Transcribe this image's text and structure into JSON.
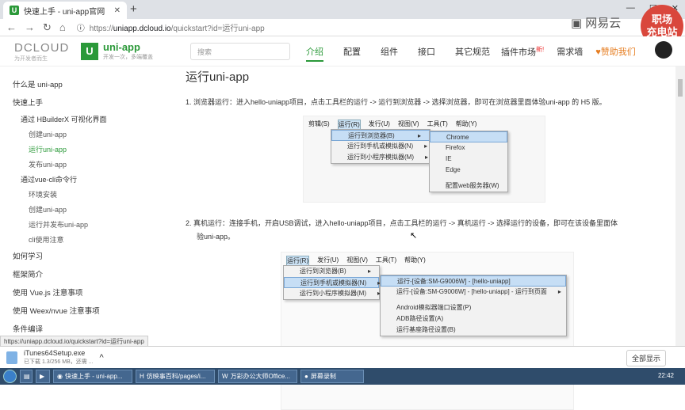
{
  "browser": {
    "tab_title": "快速上手 - uni-app官网",
    "new_tab": "+",
    "url_prefix": "https://",
    "url_host": "uniapp.dcloud.io",
    "url_path": "/quickstart?id=运行uni-app",
    "window_controls": [
      "—",
      "☐",
      "✕"
    ]
  },
  "overlay": {
    "wangyi": "网易云",
    "badge_line1": "职场",
    "badge_line2": "充电站"
  },
  "site": {
    "dcloud_logo": "DCLOUD",
    "dcloud_tagline": "为开发者而生",
    "uniapp_logo": "uni-app",
    "uniapp_tagline": "开发一次，多端覆盖",
    "search_placeholder": "搜索",
    "nav": [
      "介绍",
      "配置",
      "组件",
      "接口",
      "其它规范"
    ],
    "right_nav": {
      "plugins": "插件市场",
      "new": "新!",
      "demand": "需求墙",
      "sponsor": "赞助我们"
    }
  },
  "sidebar": [
    {
      "label": "什么是 uni-app",
      "level": 1
    },
    {
      "label": "快速上手",
      "level": 1
    },
    {
      "label": "通过 HBuilderX 可视化界面",
      "level": 2
    },
    {
      "label": "创建uni-app",
      "level": 3
    },
    {
      "label": "运行uni-app",
      "level": 3,
      "current": true
    },
    {
      "label": "发布uni-app",
      "level": 3
    },
    {
      "label": "通过vue-cli命令行",
      "level": 2
    },
    {
      "label": "环境安装",
      "level": 3
    },
    {
      "label": "创建uni-app",
      "level": 3
    },
    {
      "label": "运行并发布uni-app",
      "level": 3
    },
    {
      "label": "cli使用注意",
      "level": 3
    },
    {
      "label": "如何学习",
      "level": 1
    },
    {
      "label": "框架简介",
      "level": 1
    },
    {
      "label": "使用 Vue.js 注意事项",
      "level": 1
    },
    {
      "label": "使用 Weex/nvue 注意事项",
      "level": 1
    },
    {
      "label": "条件编译",
      "level": 1
    }
  ],
  "content": {
    "heading": "运行uni-app",
    "step1": "1. 浏览器运行：进入hello-uniapp项目，点击工具栏的运行 -> 运行到浏览器 -> 选择浏览器，即可在浏览器里面体验uni-app 的 H5 版。",
    "step2_line1": "2. 真机运行：连接手机，开启USB调试，进入hello-uniapp项目，点击工具栏的运行 -> 真机运行 -> 选择运行的设备，即可在该设备里面体",
    "step2_line2": "验uni-app。",
    "shot1": {
      "menubar": [
        "剪辑(S)",
        "运行(R)",
        "发行(U)",
        "视图(V)",
        "工具(T)",
        "帮助(Y)"
      ],
      "menu": [
        "运行到浏览器(B)",
        "运行到手机或模拟器(N)",
        "运行到小程序模拟器(M)"
      ],
      "submenu": [
        "Chrome",
        "Firefox",
        "IE",
        "Edge",
        "配置web服务器(W)"
      ]
    },
    "shot2": {
      "menubar": [
        "运行(R)",
        "发行(U)",
        "视图(V)",
        "工具(T)",
        "帮助(Y)"
      ],
      "menu": [
        "运行到浏览器(B)",
        "运行到手机或模拟器(N)",
        "运行到小程序模拟器(M)"
      ],
      "submenu": [
        "运行-[设备:SM-G9006W] - [hello-uniapp]",
        "运行-[设备:SM-G9006W] - [hello-uniapp] - 运行到页面",
        "Android模拟器端口设置(P)",
        "ADB路径设置(A)",
        "运行基座路径设置(B)"
      ]
    }
  },
  "status_url": "https://uniapp.dcloud.io/quickstart?id=运行uni-app",
  "download": {
    "name": "iTunes64Setup.exe",
    "progress": "已下载 1.3/256 MB，还需 ...",
    "show_all": "全部显示"
  },
  "taskbar": {
    "tasks": [
      "快速上手 - uni-app...",
      "仿映事百科/pages/i...",
      "万彩办公大师Office...",
      "屏幕录制"
    ],
    "clock": "22:42"
  }
}
